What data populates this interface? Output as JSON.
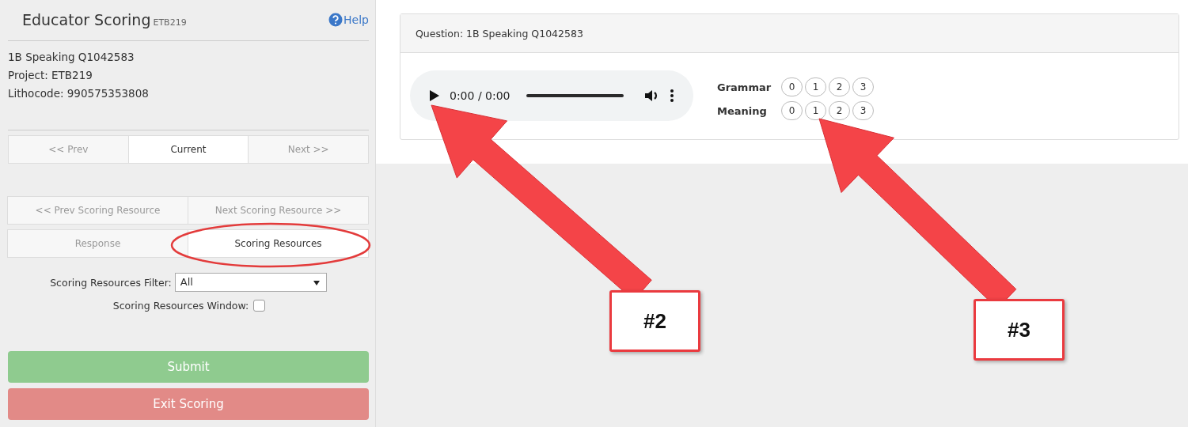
{
  "sidebar": {
    "title": "Educator Scoring",
    "subtitle": "ETB219",
    "help": "Help",
    "info": [
      "1B Speaking Q1042583",
      "Project: ETB219",
      "Lithocode: 990575353808"
    ],
    "nav": [
      {
        "label": "<< Prev",
        "selected": false
      },
      {
        "label": "Current",
        "selected": true
      },
      {
        "label": "Next >>",
        "selected": false
      }
    ],
    "resource_nav": [
      "<< Prev Scoring Resource",
      "Next Scoring Resource >>"
    ],
    "tabs": [
      {
        "label": "Response",
        "selected": false
      },
      {
        "label": "Scoring Resources",
        "selected": true
      }
    ],
    "filter": {
      "label": "Scoring Resources Filter:",
      "value": "All"
    },
    "window_option": {
      "label": "Scoring Resources Window:",
      "checked": false
    },
    "submit": "Submit",
    "exit": "Exit Scoring"
  },
  "question": {
    "title": "Question: 1B Speaking Q1042583",
    "player": {
      "time": "0:00 / 0:00",
      "level": 0
    },
    "scores": [
      {
        "label": "Grammar",
        "options": [
          {
            "label": "0",
            "selected": false
          },
          {
            "label": "1",
            "selected": false
          },
          {
            "label": "2",
            "selected": false
          },
          {
            "label": "3",
            "selected": false
          }
        ]
      },
      {
        "label": "Meaning",
        "options": [
          {
            "label": "0",
            "selected": false
          },
          {
            "label": "1",
            "selected": false
          },
          {
            "label": "2",
            "selected": false
          },
          {
            "label": "3",
            "selected": false
          }
        ]
      }
    ]
  },
  "annotations": [
    {
      "label": "#2"
    },
    {
      "label": "#3"
    }
  ]
}
